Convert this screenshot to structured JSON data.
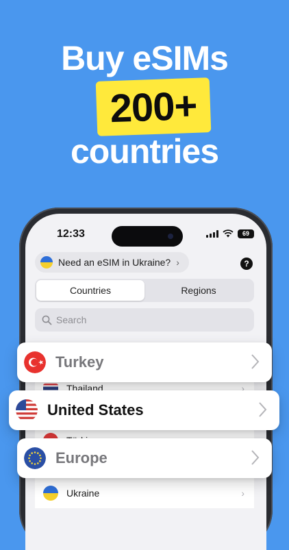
{
  "hero": {
    "line1": "Buy eSIMs",
    "highlight": "200+",
    "line3": "countries"
  },
  "status_bar": {
    "time": "12:33",
    "battery": "69"
  },
  "promo": {
    "text": "Need an eSIM in Ukraine?",
    "chevron": "›"
  },
  "help": {
    "symbol": "?"
  },
  "tabs": [
    "Countries",
    "Regions"
  ],
  "search": {
    "placeholder": "Search"
  },
  "list": {
    "thailand": "Thailand",
    "turkiye": "Türkiye",
    "ukraine": "Ukraine"
  },
  "cards": {
    "turkey": "Turkey",
    "united_states": "United States",
    "europe": "Europe"
  },
  "colors": {
    "background": "#4a97ee",
    "highlight": "#ffe93b",
    "card_text_faded": "#7a7a7e",
    "card_text_active": "#111111"
  },
  "icons": [
    "search-icon",
    "chevron-right-icon",
    "question-mark-icon",
    "wifi-icon",
    "signal-icon",
    "battery-icon"
  ]
}
